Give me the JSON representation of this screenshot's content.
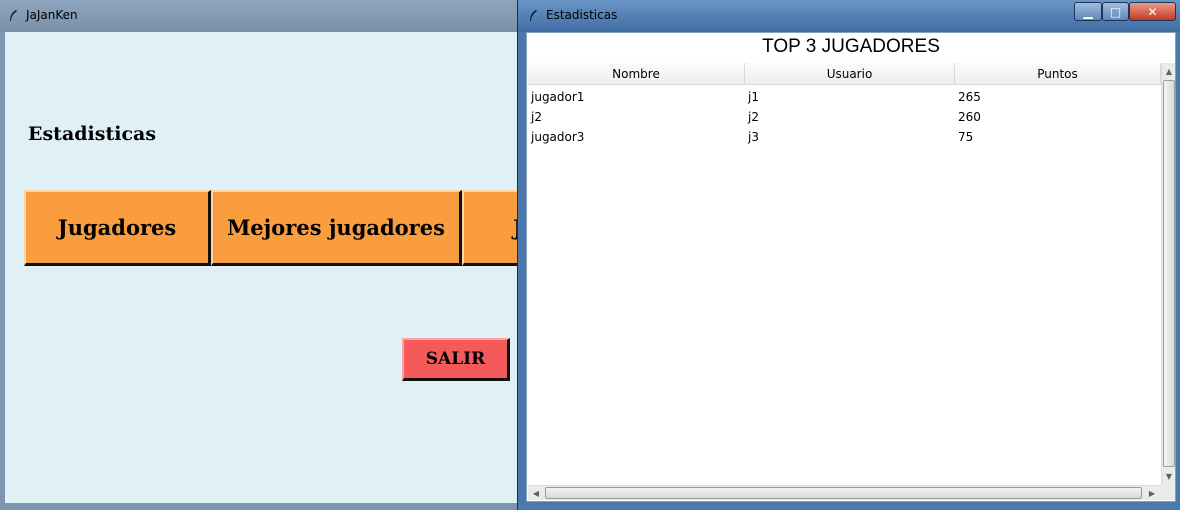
{
  "main_window": {
    "title": "JaJanKen",
    "section_label": "Estadisticas",
    "buttons": {
      "jugadores": "Jugadores",
      "mejores": "Mejores jugadores",
      "third_partial": "J",
      "salir": "SALIR"
    },
    "colors": {
      "background": "#dff0f7",
      "button": "#f99d3e",
      "salir": "#f45a5a"
    }
  },
  "stats_window": {
    "title": "Estadisticas",
    "heading": "TOP 3 JUGADORES",
    "columns": [
      "Nombre",
      "Usuario",
      "Puntos"
    ],
    "rows": [
      [
        "jugador1",
        "j1",
        "265"
      ],
      [
        "j2",
        "j2",
        "260"
      ],
      [
        "jugador3",
        "j3",
        "75"
      ]
    ],
    "controls": {
      "minimize": "▁",
      "maximize": "□",
      "close": "✕"
    }
  }
}
